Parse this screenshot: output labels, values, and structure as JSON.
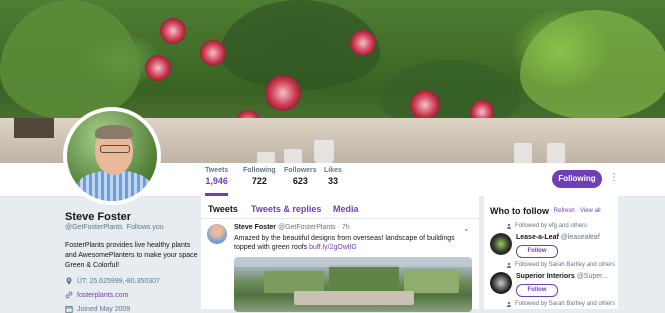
{
  "colors": {
    "accent": "#6f3fb5",
    "muted": "#657786",
    "text": "#14171a"
  },
  "nav": {
    "stats": [
      {
        "label": "Tweets",
        "value": "1,946"
      },
      {
        "label": "Following",
        "value": "722"
      },
      {
        "label": "Followers",
        "value": "623"
      },
      {
        "label": "Likes",
        "value": "33"
      }
    ],
    "follow_button": "Following",
    "more_icon": "more-vertical-icon"
  },
  "profile": {
    "name": "Steve Foster",
    "handle": "@GetFosterPlants",
    "follows_you": "Follows you",
    "bio": "FosterPlants provides live healthy plants and AwesomePlanters to make your space Green & Colorful!",
    "location": "ÜT: 25.625999,-80.350307",
    "website": "fosterplants.com",
    "joined": "Joined May 2009"
  },
  "tabs": [
    "Tweets",
    "Tweets & replies",
    "Media"
  ],
  "tweet": {
    "name": "Steve Foster",
    "handle": "@GetFosterPlants",
    "time": "· 7h",
    "text": "Amazed by the beautiful designs from overseas!  landscape of buildings topped with green roofs ",
    "link": "buff.ly/2gOwtlG"
  },
  "who_to_follow": {
    "title": "Who to follow",
    "refresh": "Refresh",
    "view_all": "View all",
    "suggestions": [
      {
        "followed_by": "Followed by efg and others",
        "name": "Lease-a-Leaf",
        "handle": "@leasealeaf",
        "button": "Follow"
      },
      {
        "followed_by": "Followed by Sarah Bartley and others",
        "name": "Superior Interiors",
        "handle": "@Super...",
        "button": "Follow"
      },
      {
        "followed_by": "Followed by Sarah Bartley and others"
      }
    ]
  }
}
